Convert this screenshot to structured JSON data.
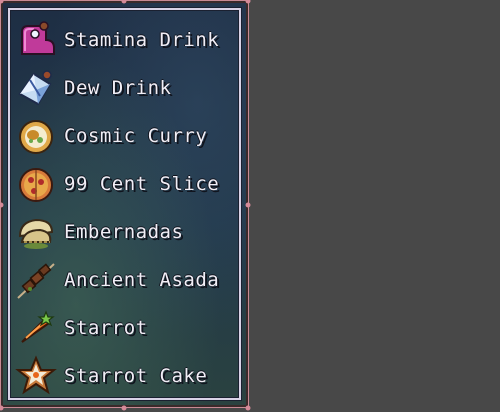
{
  "inventory": {
    "items": [
      {
        "label": "Stamina Drink",
        "icon": "stamina-drink-icon"
      },
      {
        "label": "Dew Drink",
        "icon": "dew-drink-icon"
      },
      {
        "label": "Cosmic Curry",
        "icon": "cosmic-curry-icon"
      },
      {
        "label": "99 Cent Slice",
        "icon": "pizza-slice-icon"
      },
      {
        "label": "Embernadas",
        "icon": "empanadas-icon"
      },
      {
        "label": "Ancient Asada",
        "icon": "asada-skewer-icon"
      },
      {
        "label": "Starrot",
        "icon": "starrot-icon"
      },
      {
        "label": "Starrot Cake",
        "icon": "starrot-cake-icon"
      }
    ]
  },
  "colors": {
    "background": "#484848",
    "panel": "#22384a",
    "frame": "#d8d2e6",
    "text": "#f1eef6",
    "selection_handles": "#d58a98"
  }
}
